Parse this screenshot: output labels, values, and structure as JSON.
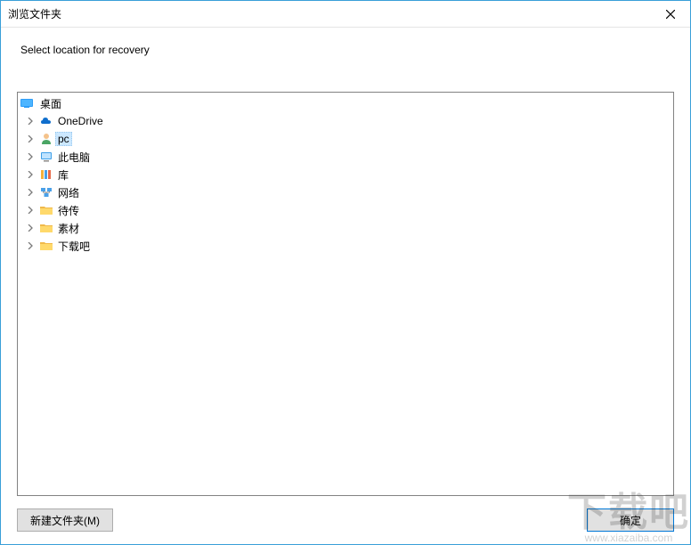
{
  "titlebar": {
    "title": "浏览文件夹"
  },
  "instruction": "Select location for recovery",
  "tree": {
    "root": {
      "label": "桌面",
      "icon": "desktop"
    },
    "items": [
      {
        "label": "OneDrive",
        "icon": "onedrive",
        "selected": false
      },
      {
        "label": "pc",
        "icon": "user",
        "selected": true
      },
      {
        "label": "此电脑",
        "icon": "thispc",
        "selected": false
      },
      {
        "label": "库",
        "icon": "libraries",
        "selected": false
      },
      {
        "label": "网络",
        "icon": "network",
        "selected": false
      },
      {
        "label": "待传",
        "icon": "folder",
        "selected": false
      },
      {
        "label": "素材",
        "icon": "folder",
        "selected": false
      },
      {
        "label": "下载吧",
        "icon": "folder",
        "selected": false
      }
    ]
  },
  "buttons": {
    "new_folder": "新建文件夹(M)",
    "ok": "确定"
  },
  "watermark": {
    "text": "下载吧",
    "url": "www.xiazaiba.com"
  }
}
